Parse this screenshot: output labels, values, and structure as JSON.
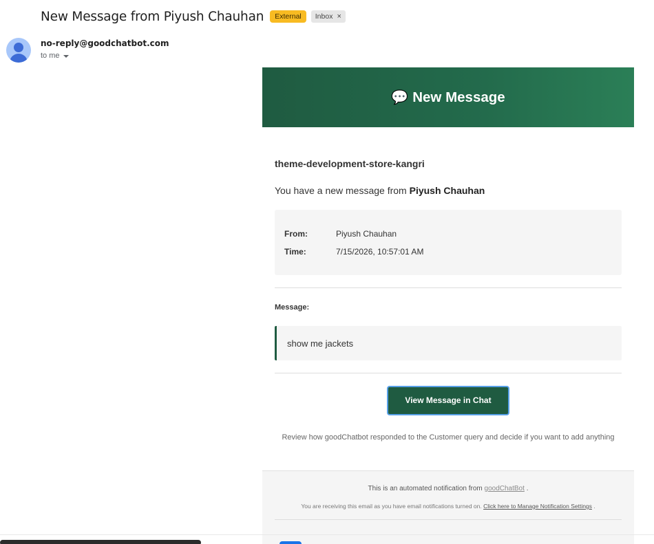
{
  "subject": {
    "title": "New Message from Piyush Chauhan",
    "label_external": "External",
    "label_inbox": "Inbox",
    "label_remove": "×"
  },
  "sender": {
    "email": "no-reply@goodchatbot.com",
    "recipient": "to me"
  },
  "email": {
    "header_icon": "💬",
    "header_title": "New Message",
    "store_name": "theme-development-store-kangri",
    "intro_text": "You have a new message from",
    "intro_name": "Piyush Chauhan",
    "info": [
      {
        "label": "From:",
        "value": "Piyush Chauhan"
      },
      {
        "label": "Time:",
        "value": "7/15/2026, 10:57:01 AM"
      }
    ],
    "message_label": "Message:",
    "message_text": "show me jackets",
    "button_label": "View Message in Chat",
    "review_text": "Review how goodChatbot responded to the Customer query and decide if you want to add anything",
    "footer": {
      "line1_prefix": "This is an automated notification from",
      "line1_link": "goodChatBot",
      "line1_suffix": ".",
      "line2_prefix": "You are receiving this email as you have email notifications turned on.",
      "line2_link": "Click here to Manage Notification Settings",
      "line2_suffix": "."
    }
  },
  "colors": {
    "header_green": "#236b4c",
    "button_green": "#1f5b41",
    "external_badge": "#f8bb22",
    "avatar_bg": "#a8c7fa"
  }
}
